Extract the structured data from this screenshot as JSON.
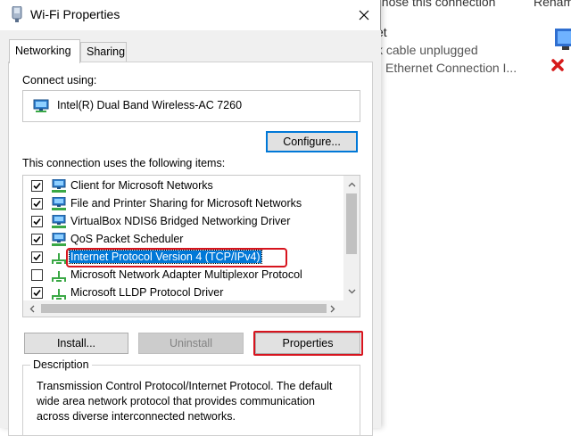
{
  "background_window": {
    "commands": [
      "gnose this connection",
      "Renam"
    ],
    "connection": {
      "name": "et",
      "status": "k cable unplugged",
      "adapter": "Ethernet Connection I..."
    }
  },
  "dialog": {
    "title": "Wi-Fi Properties",
    "close_icon": "close-icon",
    "tabs": [
      {
        "label": "Networking",
        "active": true
      },
      {
        "label": "Sharing",
        "active": false
      }
    ],
    "connect_using_label": "Connect using:",
    "adapter_name": "Intel(R) Dual Band Wireless-AC 7260",
    "configure_label": "Configure...",
    "items_label": "This connection uses the following items:",
    "items": [
      {
        "label": "Client for Microsoft Networks",
        "checked": true,
        "icon": "network-client-icon"
      },
      {
        "label": "File and Printer Sharing for Microsoft Networks",
        "checked": true,
        "icon": "network-service-icon"
      },
      {
        "label": "VirtualBox NDIS6 Bridged Networking Driver",
        "checked": true,
        "icon": "network-service-icon"
      },
      {
        "label": "QoS Packet Scheduler",
        "checked": true,
        "icon": "network-service-icon"
      },
      {
        "label": "Internet Protocol Version 4 (TCP/IPv4)",
        "checked": true,
        "icon": "protocol-icon",
        "selected": true
      },
      {
        "label": "Microsoft Network Adapter Multiplexor Protocol",
        "checked": false,
        "icon": "protocol-icon"
      },
      {
        "label": "Microsoft LLDP Protocol Driver",
        "checked": true,
        "icon": "protocol-icon"
      }
    ],
    "install_label": "Install...",
    "uninstall_label": "Uninstall",
    "properties_label": "Properties",
    "description_legend": "Description",
    "description_text": "Transmission Control Protocol/Internet Protocol. The default wide area network protocol that provides communication across diverse interconnected networks.",
    "colors": {
      "selection": "#0078d7",
      "annotation": "#d7141e",
      "disabled_text": "#838383"
    }
  }
}
